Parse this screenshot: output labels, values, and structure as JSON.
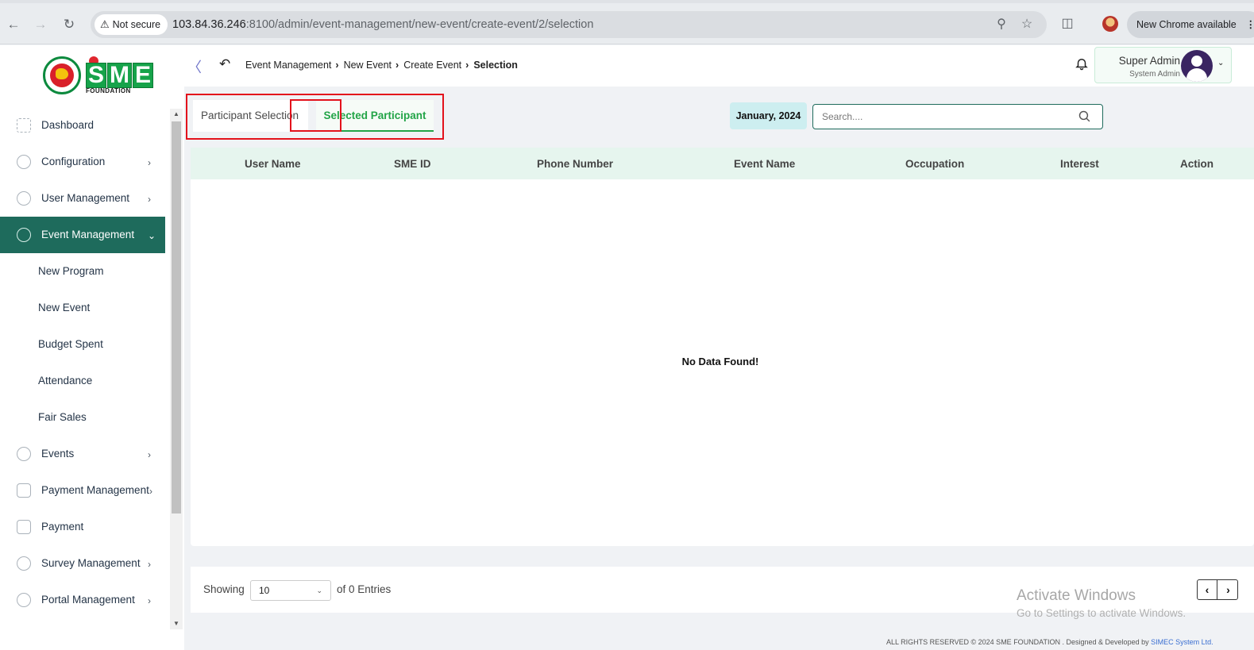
{
  "browser": {
    "security_label": "Not secure",
    "url_host": "103.84.36.246",
    "url_path": ":8100/admin/event-management/new-event/create-event/2/selection",
    "update_label": "New Chrome available"
  },
  "sidebar": {
    "logo_text": "SME",
    "logo_subtext": "FOUNDATION",
    "items": [
      {
        "label": "Dashboard",
        "has_chevron": false
      },
      {
        "label": "Configuration",
        "has_chevron": true
      },
      {
        "label": "User Management",
        "has_chevron": true
      },
      {
        "label": "Event Management",
        "has_chevron": true,
        "active": true
      },
      {
        "label": "Events",
        "has_chevron": true
      },
      {
        "label": "Payment Management",
        "has_chevron": true
      },
      {
        "label": "Payment",
        "has_chevron": false
      },
      {
        "label": "Survey Management",
        "has_chevron": true
      },
      {
        "label": "Portal Management",
        "has_chevron": true
      }
    ],
    "sub_items": [
      "New Program",
      "New Event",
      "Budget Spent",
      "Attendance",
      "Fair Sales"
    ]
  },
  "header": {
    "breadcrumb": [
      "Event Management",
      "New Event",
      "Create Event",
      "Selection"
    ],
    "user_name": "Super Admin",
    "user_role": "System Admin"
  },
  "tabs": {
    "participant_selection": "Participant Selection",
    "selected_participant": "Selected Participant"
  },
  "filter": {
    "month": "January, 2024",
    "search_placeholder": "Search...."
  },
  "table": {
    "columns": [
      "User Name",
      "SME ID",
      "Phone Number",
      "Event Name",
      "Occupation",
      "Interest",
      "Action"
    ],
    "rows": [],
    "empty_text": "No Data Found!"
  },
  "pagination": {
    "showing_label": "Showing",
    "page_size": "10",
    "entries_label": "of 0 Entries"
  },
  "watermark": {
    "title": "Activate Windows",
    "subtitle": "Go to Settings to activate Windows."
  },
  "footer": {
    "copyright": "ALL RIGHTS RESERVED © 2024 SME FOUNDATION . Designed & Developed by",
    "developer": "SIMEC System Ltd."
  },
  "colors": {
    "brand_green": "#22a447",
    "sidebar_active": "#1e6b5c",
    "table_header_bg": "#e6f5ee",
    "annotation_red": "#e3121c"
  }
}
